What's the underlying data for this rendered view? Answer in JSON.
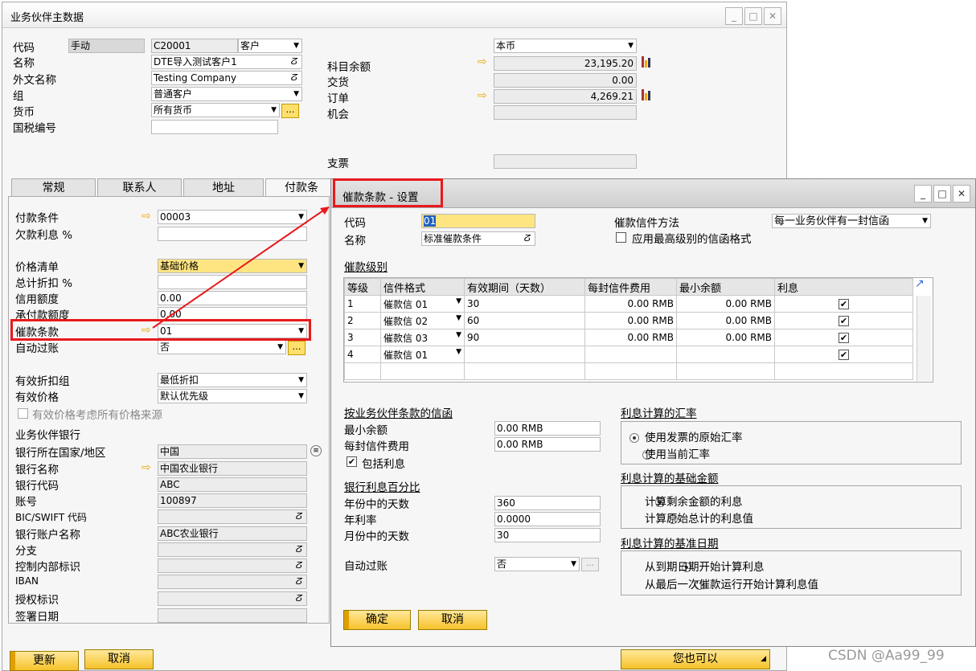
{
  "main": {
    "title": "业务伙伴主数据",
    "header": {
      "code_label": "代码",
      "code_mode": "手动",
      "code_value": "C20001",
      "bp_type": "客户",
      "name_label": "名称",
      "name_value": "DTE导入测试客户1",
      "foreign_label": "外文名称",
      "foreign_value": "Testing Company",
      "group_label": "组",
      "group_value": "普通客户",
      "currency_label": "货币",
      "currency_value": "所有货币",
      "taxid_label": "国税编号",
      "balance_currency": "本币",
      "balance_label": "科目余额",
      "balance_value": "23,195.20",
      "delivery_label": "交货",
      "delivery_value": "0.00",
      "orders_label": "订单",
      "orders_value": "4,269.21",
      "opportunity_label": "机会",
      "cheques_label": "支票"
    },
    "tabs": [
      "常规",
      "联系人",
      "地址",
      "付款条"
    ],
    "payment": {
      "terms_label": "付款条件",
      "terms_value": "00003",
      "interest_label": "欠款利息 %",
      "pricelist_label": "价格清单",
      "pricelist_value": "基础价格",
      "discount_label": "总计折扣 %",
      "credit_label": "信用额度",
      "credit_value": "0.00",
      "commit_label": "承付款额度",
      "commit_value": "0.00",
      "dunning_label": "催款条款",
      "dunning_value": "01",
      "autopost_label": "自动过账",
      "autopost_value": "否",
      "effdisc_label": "有效折扣组",
      "effdisc_value": "最低折扣",
      "effprice_label": "有效价格",
      "effprice_value": "默认优先级",
      "allprice_label": "有效价格考虑所有价格来源",
      "bank_section": "业务伙伴银行",
      "country_label": "银行所在国家/地区",
      "country_value": "中国",
      "bankname_label": "银行名称",
      "bankname_value": "中国农业银行",
      "bankcode_label": "银行代码",
      "bankcode_value": "ABC",
      "account_label": "账号",
      "account_value": "100897",
      "swift_label": "BIC/SWIFT 代码",
      "accname_label": "银行账户名称",
      "accname_value": "ABC农业银行",
      "branch_label": "分支",
      "ctrl_label": "控制内部标识",
      "iban_label": "IBAN",
      "mandate_label": "授权标识",
      "signdate_label": "签署日期"
    },
    "buttons": {
      "update": "更新",
      "cancel": "取消",
      "youcan": "您也可以"
    }
  },
  "dialog": {
    "title": "催款条款 - 设置",
    "code_label": "代码",
    "code_value": "01",
    "name_label": "名称",
    "name_value": "标准催款条件",
    "method_label": "催款信件方法",
    "method_value": "每一业务伙伴有一封信函",
    "highest_label": "应用最高级别的信函格式",
    "levels_label": "催款级别",
    "columns": [
      "等级",
      "信件格式",
      "有效期间（天数）",
      "每封信件费用",
      "最小余额",
      "利息"
    ],
    "rows": [
      {
        "level": "1",
        "format": "催款信 01",
        "days": "30",
        "fee": "0.00 RMB",
        "min": "0.00 RMB",
        "interest": "✔"
      },
      {
        "level": "2",
        "format": "催款信 02",
        "days": "60",
        "fee": "0.00 RMB",
        "min": "0.00 RMB",
        "interest": "✔"
      },
      {
        "level": "3",
        "format": "催款信 03",
        "days": "90",
        "fee": "0.00 RMB",
        "min": "0.00 RMB",
        "interest": "✔"
      },
      {
        "level": "4",
        "format": "催款信 01",
        "days": "",
        "fee": "",
        "min": "",
        "interest": "✔"
      }
    ],
    "letter_section": "按业务伙伴条款的信函",
    "minbal_label": "最小余额",
    "minbal_value": "0.00 RMB",
    "fee_label": "每封信件费用",
    "fee_value": "0.00 RMB",
    "incl_label": "包括利息",
    "bankpct_section": "银行利息百分比",
    "days_year_label": "年份中的天数",
    "days_year_value": "360",
    "rate_label": "年利率",
    "rate_value": "0.0000",
    "days_month_label": "月份中的天数",
    "days_month_value": "30",
    "autopost_label": "自动过账",
    "autopost_value": "否",
    "rate_section": "利息计算的汇率",
    "rate_opt1": "使用发票的原始汇率",
    "rate_opt2": "使用当前汇率",
    "base_section": "利息计算的基础金额",
    "base_opt1": "计算剩余金额的利息",
    "base_opt2": "计算原始总计的利息值",
    "date_section": "利息计算的基准日期",
    "date_opt1": "从到期日期开始计算利息",
    "date_opt2": "从最后一次催款运行开始计算利息值",
    "ok": "确定",
    "cancel": "取消"
  },
  "watermark": "CSDN @Aa99_99",
  "colors": {
    "highlight": "#e8191c",
    "accent": "#f6c22b"
  }
}
